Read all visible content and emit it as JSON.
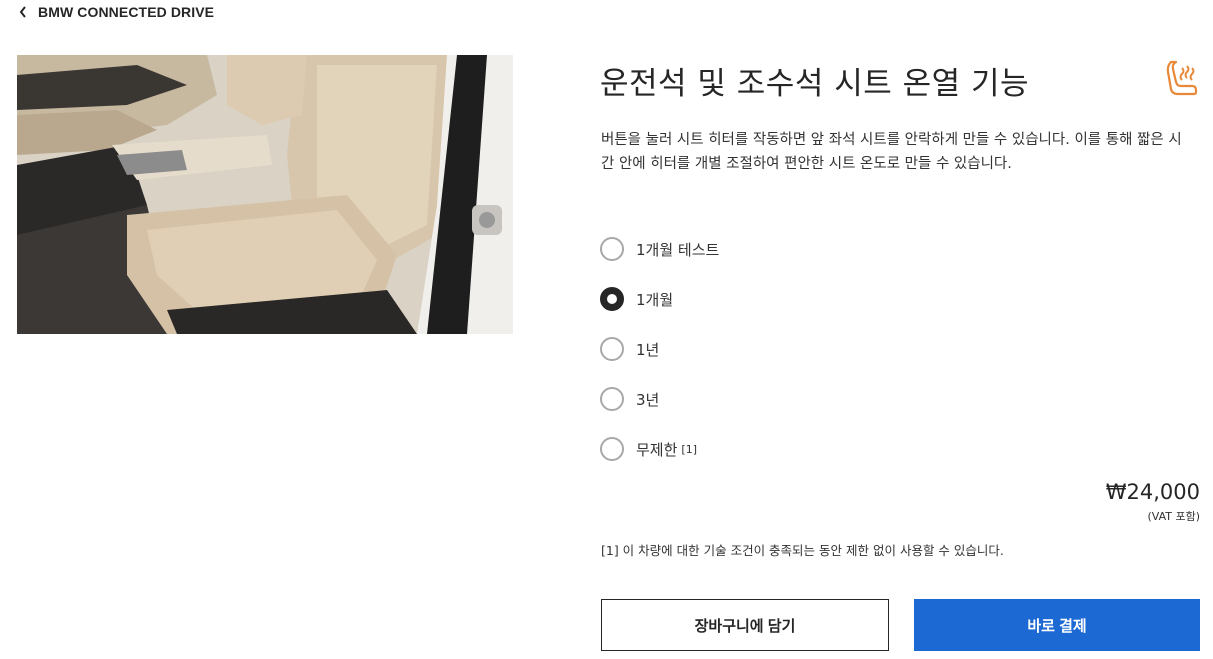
{
  "nav": {
    "back_label": "BMW CONNECTED DRIVE"
  },
  "product": {
    "title": "운전석 및 조수석 시트 온열 기능",
    "description": "버튼을 눌러 시트 히터를 작동하면 앞 좌석 시트를 안락하게 만들 수 있습니다. 이를 통해 짧은 시간 안에 히터를 개별 조절하여 편안한 시트 온도로 만들 수 있습니다.",
    "icon": "seat-heating-icon",
    "icon_color": "#e8893a"
  },
  "options": [
    {
      "label": "1개월 테스트",
      "selected": false,
      "note": ""
    },
    {
      "label": "1개월",
      "selected": true,
      "note": ""
    },
    {
      "label": "1년",
      "selected": false,
      "note": ""
    },
    {
      "label": "3년",
      "selected": false,
      "note": ""
    },
    {
      "label": "무제한",
      "selected": false,
      "note": "[1]"
    }
  ],
  "price": {
    "amount": "₩24,000",
    "vat_note": "(VAT 포함)"
  },
  "footnote": "[1] 이 차량에 대한 기술 조건이 충족되는 동안 제한 없이 사용할 수 있습니다.",
  "actions": {
    "cart_label": "장바구니에 담기",
    "buy_label": "바로 결제"
  },
  "colors": {
    "primary_button": "#1c69d4",
    "text": "#262626"
  }
}
